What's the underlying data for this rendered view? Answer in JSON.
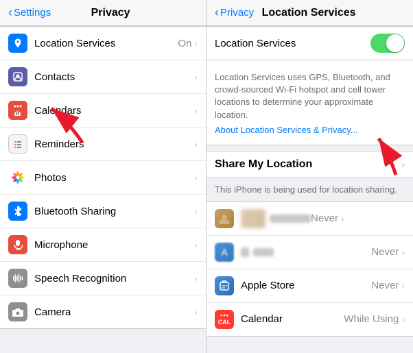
{
  "nav": {
    "left": {
      "back_label": "Settings",
      "title": "Privacy"
    },
    "right": {
      "back_label": "Privacy",
      "title": "Location Services"
    }
  },
  "left_panel": {
    "items": [
      {
        "id": "location-services",
        "label": "Location Services",
        "value": "On",
        "icon_type": "location"
      },
      {
        "id": "contacts",
        "label": "Contacts",
        "value": "",
        "icon_type": "contacts"
      },
      {
        "id": "calendars",
        "label": "Calendars",
        "value": "",
        "icon_type": "calendars"
      },
      {
        "id": "reminders",
        "label": "Reminders",
        "value": "",
        "icon_type": "reminders"
      },
      {
        "id": "photos",
        "label": "Photos",
        "value": "",
        "icon_type": "photos"
      },
      {
        "id": "bluetooth",
        "label": "Bluetooth Sharing",
        "value": "",
        "icon_type": "bluetooth"
      },
      {
        "id": "microphone",
        "label": "Microphone",
        "value": "",
        "icon_type": "microphone"
      },
      {
        "id": "speech",
        "label": "Speech Recognition",
        "value": "",
        "icon_type": "speech"
      },
      {
        "id": "camera",
        "label": "Camera",
        "value": "",
        "icon_type": "camera"
      }
    ]
  },
  "right_panel": {
    "toggle_label": "Location Services",
    "toggle_on": true,
    "description": "Location Services uses GPS, Bluetooth, and crowd-sourced Wi-Fi hotspot and cell tower locations to determine your approximate location.",
    "link_text": "About Location Services & Privacy...",
    "share_section_label": "Share My Location",
    "share_description": "This iPhone is being used for location sharing.",
    "apps": [
      {
        "id": "app1",
        "name": "",
        "permission": "Never",
        "icon_type": "person"
      },
      {
        "id": "app2",
        "name": "",
        "permission": "Never",
        "icon_type": "app-store"
      },
      {
        "id": "apple-store",
        "name": "Apple Store",
        "permission": "Never",
        "icon_type": "apple-store-bag"
      },
      {
        "id": "calendar",
        "name": "Calendar",
        "permission": "While Using",
        "icon_type": "calendar-app"
      }
    ]
  }
}
